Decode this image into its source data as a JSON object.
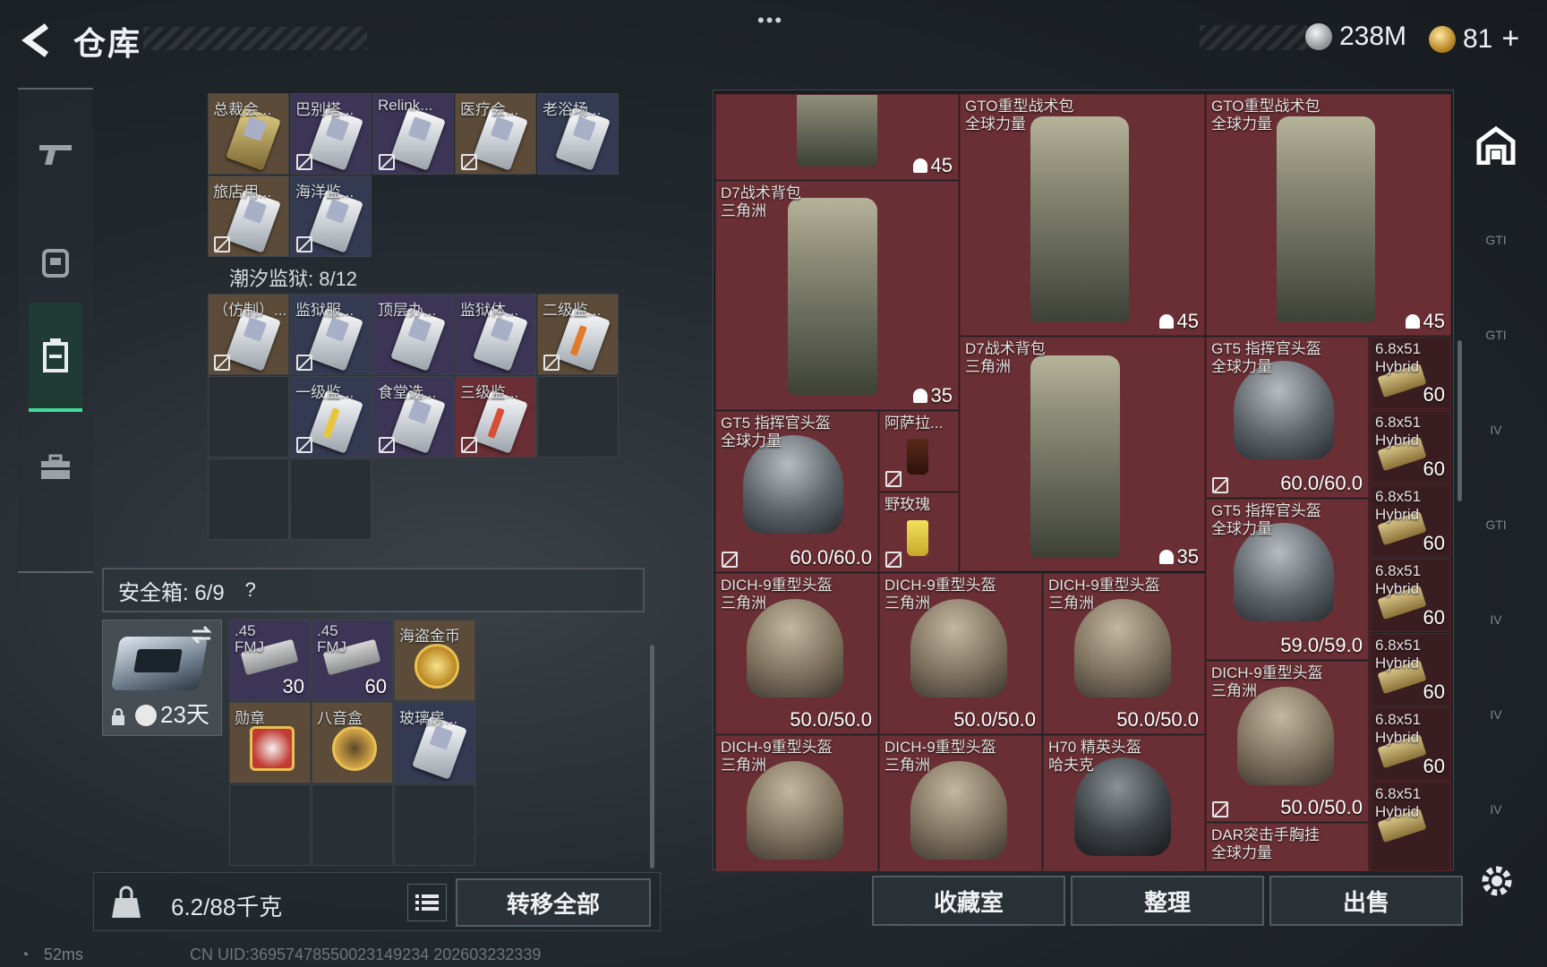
{
  "header": {
    "title": "仓库",
    "more": "•••",
    "currency_silver": "238M",
    "currency_gold": "81",
    "gold_plus": "+"
  },
  "stash": {
    "row1": [
      "总裁会...",
      "巴别塔...",
      "Relink...",
      "医疗会...",
      "老浴场..."
    ],
    "row2": [
      "旅店用...",
      "海洋监..."
    ],
    "section_label": "潮汐监狱: 8/12",
    "row3": [
      "（仿制）...",
      "监狱服...",
      "顶层办...",
      "监狱体...",
      "二级监..."
    ],
    "row4": [
      "一级监...",
      "食堂选...",
      "三级监..."
    ]
  },
  "safe": {
    "label": "安全箱: 6/9",
    "help": "?",
    "days": "23天",
    "items": [
      {
        "label": ".45\nFMJ",
        "qty": "30"
      },
      {
        "label": ".45\nFMJ",
        "qty": "60"
      },
      {
        "label": "海盗金币",
        "qty": ""
      },
      {
        "label": "勋章",
        "qty": ""
      },
      {
        "label": "八音盒",
        "qty": ""
      },
      {
        "label": "玻璃房...",
        "qty": ""
      }
    ]
  },
  "bottom_left": {
    "weight": "6.2/88千克",
    "transfer_all": "转移全部"
  },
  "status": {
    "ping": "52ms",
    "uid": "CN UID:3695747855002314923​4 202603232339"
  },
  "storage": {
    "items": [
      {
        "id": "bp-top",
        "label": "",
        "value": "45"
      },
      {
        "id": "gto1",
        "label": "GTO重型战术包\n全球力量",
        "value": "45"
      },
      {
        "id": "gto2",
        "label": "GTO重型战术包\n全球力量",
        "value": "45"
      },
      {
        "id": "d7a",
        "label": "D7战术背包\n三角洲",
        "value": "35"
      },
      {
        "id": "d7b",
        "label": "D7战术背包\n三角洲",
        "value": "35"
      },
      {
        "id": "gt5a",
        "label": "GT5 指挥官头盔\n全球力量",
        "value": "60.0/60.0"
      },
      {
        "id": "gt5b",
        "label": "GT5 指挥官头盔\n全球力量",
        "value": "60.0/60.0"
      },
      {
        "id": "gt5c",
        "label": "GT5 指挥官头盔\n全球力量",
        "value": "59.0/59.0"
      },
      {
        "id": "asala",
        "label": "阿萨拉...",
        "value": ""
      },
      {
        "id": "rose",
        "label": "野玫瑰",
        "value": ""
      },
      {
        "id": "dich1",
        "label": "DICH-9重型头盔\n三角洲",
        "value": "50.0/50.0"
      },
      {
        "id": "dich2",
        "label": "DICH-9重型头盔\n三角洲",
        "value": "50.0/50.0"
      },
      {
        "id": "dich3",
        "label": "DICH-9重型头盔\n三角洲",
        "value": "50.0/50.0"
      },
      {
        "id": "dich4",
        "label": "DICH-9重型头盔\n三角洲",
        "value": "50.0/50.0"
      },
      {
        "id": "dich5",
        "label": "DICH-9重型头盔\n三角洲",
        "value": ""
      },
      {
        "id": "dich6",
        "label": "DICH-9重型头盔\n三角洲",
        "value": ""
      },
      {
        "id": "h70",
        "label": "H70 精英头盔\n哈夫克",
        "value": ""
      },
      {
        "id": "dar",
        "label": "DAR突击手胸挂\n全球力量",
        "value": ""
      },
      {
        "id": "am1",
        "label": "6.8x51\nHybrid",
        "value": "60"
      },
      {
        "id": "am2",
        "label": "6.8x51\nHybrid",
        "value": "60"
      },
      {
        "id": "am3",
        "label": "6.8x51\nHybrid",
        "value": "60"
      },
      {
        "id": "am4",
        "label": "6.8x51\nHybrid",
        "value": "60"
      },
      {
        "id": "am5",
        "label": "6.8x51\nHybrid",
        "value": "60"
      },
      {
        "id": "am6",
        "label": "6.8x51\nHybrid",
        "value": "60"
      },
      {
        "id": "am7",
        "label": "6.8x51\nHybrid",
        "value": ""
      }
    ]
  },
  "buttons": {
    "collection": "收藏室",
    "sort": "整理",
    "sell": "出售"
  },
  "right_tabs": [
    "GTI",
    "GTI",
    "IV",
    "GTI",
    "IV",
    "IV",
    "IV"
  ]
}
